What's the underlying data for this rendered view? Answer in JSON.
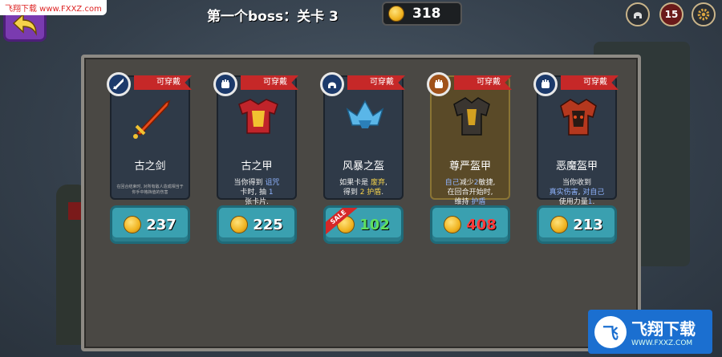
{
  "watermark_top": "飞翔下载 www.FXXZ.com",
  "header": {
    "title_prefix": "第一个",
    "title_boss": "boss",
    "title_sep": "：关卡",
    "title_level": "3",
    "coins": "318",
    "badge_count": "15"
  },
  "cards": [
    {
      "name": "古之剑",
      "tag": "可穿戴",
      "desc": "在回合结束时, 对所有敌人造成相当于你手中格挡值的伤害",
      "price": "237",
      "icon": "sword-icon",
      "art": "sword",
      "style": "normal",
      "price_color": "white"
    },
    {
      "name": "古之甲",
      "tag": "可穿戴",
      "desc_parts": [
        "当你得到 ",
        "诅咒",
        " 卡时, 抽 ",
        "1",
        " 张卡片."
      ],
      "price": "225",
      "icon": "fist-icon",
      "art": "armor",
      "style": "normal",
      "price_color": "white"
    },
    {
      "name": "风暴之盔",
      "tag": "可穿戴",
      "desc_parts": [
        "如果卡是 ",
        "废弃",
        ",",
        " 得到 ",
        "2 护盾",
        "."
      ],
      "price": "102",
      "icon": "helmet-icon",
      "art": "helmet",
      "style": "normal",
      "price_color": "green",
      "sale": "SALE"
    },
    {
      "name": "尊严盔甲",
      "tag": "可穿戴",
      "desc_parts": [
        "自己",
        "减少",
        "2",
        "敏捷,",
        "在回合开始时,",
        "维持 ",
        "护盾"
      ],
      "price": "408",
      "icon": "fist-icon",
      "art": "dark-armor",
      "style": "gold",
      "price_color": "red"
    },
    {
      "name": "恶魔盔甲",
      "tag": "可穿戴",
      "desc_parts": [
        "当你收到",
        "真实伤害",
        ",",
        " 对自己",
        "使用力量",
        "1",
        "."
      ],
      "price": "213",
      "icon": "fist-icon",
      "art": "demon-armor",
      "style": "normal",
      "price_color": "white"
    }
  ],
  "watermark_br": {
    "logo": "飞",
    "main": "飞翔下载",
    "sub": "WWW.FXXZ.COM",
    "corner": "WWW.FXXZ.COM"
  }
}
